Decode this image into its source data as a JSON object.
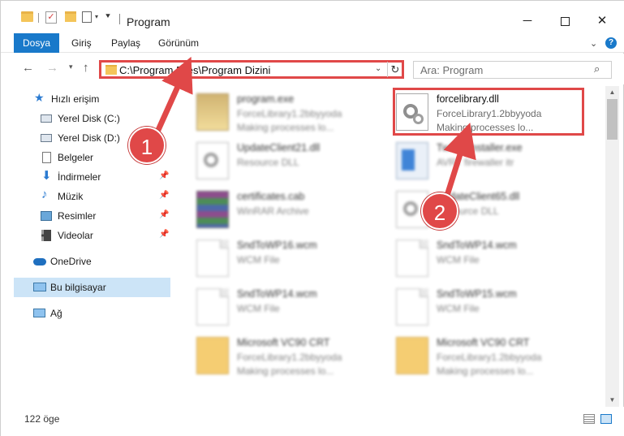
{
  "window": {
    "title": "Program",
    "minimize": "─",
    "close": "✕"
  },
  "ribbon": {
    "tabs": [
      "Dosya",
      "Giriş",
      "Paylaş",
      "Görünüm"
    ],
    "help": "?"
  },
  "nav": {
    "back": "←",
    "forward": "→",
    "recent": "▾",
    "up": "↑",
    "address": "C:\\Program Files\\Program Dizini",
    "refresh": "↻",
    "search_placeholder": "Ara: Program"
  },
  "sidebar": {
    "items": [
      {
        "label": "Hızlı erişim",
        "icon": "star-icon",
        "pinned": false
      },
      {
        "label": "Yerel Disk (C:)",
        "icon": "drive-icon",
        "pinned": false
      },
      {
        "label": "Yerel Disk (D:)",
        "icon": "drive-icon",
        "pinned": false
      },
      {
        "label": "Belgeler",
        "icon": "documents-icon",
        "pinned": false
      },
      {
        "label": "İndirmeler",
        "icon": "download-icon",
        "pinned": true
      },
      {
        "label": "Müzik",
        "icon": "music-icon",
        "pinned": true
      },
      {
        "label": "Resimler",
        "icon": "pictures-icon",
        "pinned": true
      },
      {
        "label": "Videolar",
        "icon": "videos-icon",
        "pinned": true
      },
      {
        "label": "OneDrive",
        "icon": "onedrive-icon",
        "pinned": false
      },
      {
        "label": "Bu bilgisayar",
        "icon": "computer-icon",
        "pinned": false,
        "selected": true
      },
      {
        "label": "Ağ",
        "icon": "network-icon",
        "pinned": false
      }
    ]
  },
  "files": [
    {
      "name": "program.exe",
      "line1": "ForceLibrary1.2bbyyoda",
      "line2": "Making processes lo...",
      "icon": "exe-icon"
    },
    {
      "name": "forcelibrary.dll",
      "line1": "ForceLibrary1.2bbyyoda",
      "line2": "Making processes lo...",
      "icon": "dll-icon"
    },
    {
      "name": "UpdateClient21.dll",
      "line1": "Resource DLL",
      "line2": "",
      "icon": "dll-icon"
    },
    {
      "name": "Twinuninstaller.exe",
      "line1": "AVRT firewaller itr",
      "line2": "",
      "icon": "installer-icon"
    },
    {
      "name": "certificates.cab",
      "line1": "WinRAR Archive",
      "line2": "",
      "icon": "archive-icon"
    },
    {
      "name": "UpdateClient65.dll",
      "line1": "Resource DLL",
      "line2": "",
      "icon": "dll-icon"
    },
    {
      "name": "SndToWP16.wcm",
      "line1": "WCM File",
      "line2": "",
      "icon": "document-icon"
    },
    {
      "name": "SndToWP14.wcm",
      "line1": "WCM File",
      "line2": "",
      "icon": "document-icon"
    },
    {
      "name": "SndToWP14.wcm",
      "line1": "WCM File",
      "line2": "",
      "icon": "document-icon"
    },
    {
      "name": "SndToWP15.wcm",
      "line1": "WCM File",
      "line2": "",
      "icon": "document-icon"
    },
    {
      "name": "Microsoft VC90 CRT",
      "line1": "ForceLibrary1.2bbyyoda",
      "line2": "Making processes lo...",
      "icon": "folder-doc-icon"
    },
    {
      "name": "Microsoft VC90 CRT",
      "line1": "ForceLibrary1.2bbyyoda",
      "line2": "Making processes lo...",
      "icon": "folder-doc-icon"
    }
  ],
  "status": {
    "count": "122 öge"
  },
  "annotations": {
    "step1": "1",
    "step2": "2",
    "color": "#e04848"
  },
  "colors": {
    "accent": "#1979ca",
    "selection": "#cce4f7",
    "annotation": "#e04848"
  }
}
